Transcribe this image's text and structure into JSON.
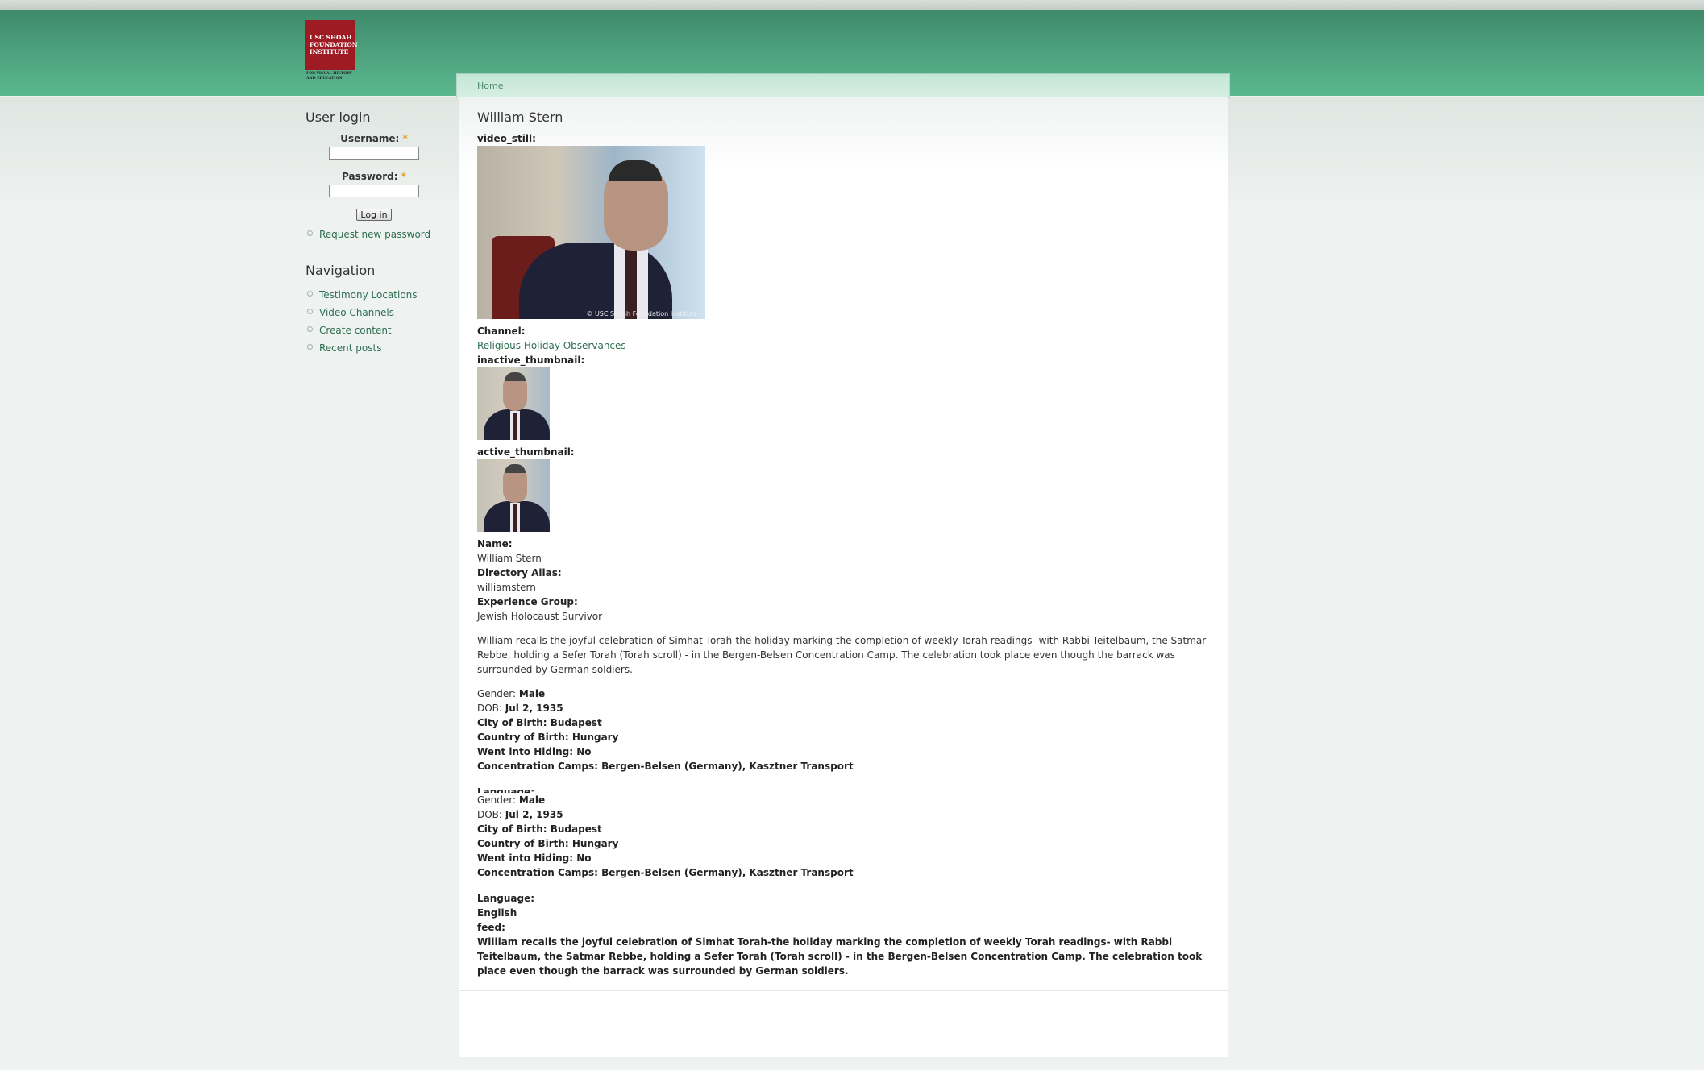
{
  "brand": {
    "logo_text": "USC SHOAH FOUNDATION INSTITUTE",
    "logo_subtext": "FOR VISUAL HISTORY AND EDUCATION"
  },
  "breadcrumb": {
    "home": "Home"
  },
  "login": {
    "title": "User login",
    "username_label": "Username:",
    "password_label": "Password:",
    "required_mark": "*",
    "button": "Log in",
    "request_password": "Request new password"
  },
  "navigation": {
    "title": "Navigation",
    "items": [
      "Testimony Locations",
      "Video Channels",
      "Create content",
      "Recent posts"
    ]
  },
  "page": {
    "title": "William Stern",
    "video_still_label": "video_still:",
    "video_still_watermark": "© USC Shoah Foundation Institute",
    "channel_label": "Channel:",
    "channel_value": "Religious Holiday Observances",
    "inactive_thumbnail_label": "inactive_thumbnail:",
    "active_thumbnail_label": "active_thumbnail:",
    "name_label": "Name:",
    "name_value": "William Stern",
    "alias_label": "Directory Alias:",
    "alias_value": "williamstern",
    "group_label": "Experience Group:",
    "group_value": "Jewish Holocaust Survivor",
    "description": "William recalls the joyful celebration of Simhat Torah-the holiday marking the completion of weekly Torah readings- with Rabbi Teitelbaum, the Satmar Rebbe, holding a Sefer Torah (Torah scroll) - in the Bergen-Belsen Concentration Camp. The celebration took place even though the barrack was surrounded by German soldiers.",
    "details": {
      "gender_label": "Gender:",
      "gender_value": "Male",
      "dob_label": "DOB:",
      "dob_value": "Jul 2, 1935",
      "city": "City of Birth: Budapest",
      "country": "Country of Birth: Hungary",
      "hiding": "Went into Hiding: No",
      "camps": "Concentration Camps: Bergen-Belsen (Germany), Kasztner Transport"
    },
    "language_label": "Language:",
    "language_value": "English",
    "feed_label": "feed:",
    "feed_value": "William recalls the joyful celebration of Simhat Torah-the holiday marking the completion of weekly Torah readings- with Rabbi Teitelbaum, the Satmar Rebbe, holding a Sefer Torah (Torah scroll) - in the Bergen-Belsen Concentration Camp. The celebration took place even though the barrack was surrounded by German soldiers."
  }
}
